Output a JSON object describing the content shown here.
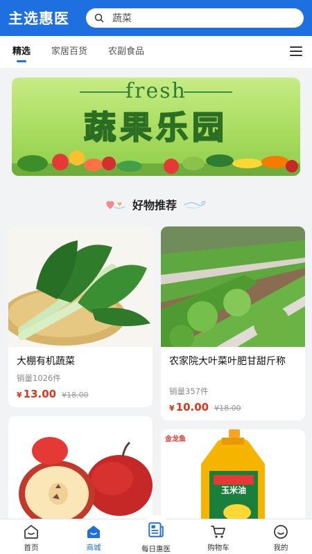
{
  "header": {
    "logo": "主选惠医",
    "search_text": "蔬菜",
    "brand_color": "#1e6fe0"
  },
  "tabs": [
    {
      "label": "精选",
      "active": true
    },
    {
      "label": "家居百货",
      "active": false
    },
    {
      "label": "农副食品",
      "active": false
    }
  ],
  "banner": {
    "subtitle": "fresh",
    "title": "蔬果乐园"
  },
  "section": {
    "title": "好物推荐"
  },
  "products": [
    {
      "name": "大棚有机蔬菜",
      "sales": "销量1026件",
      "currency": "¥",
      "price": "13.00",
      "old_price": "¥18.00",
      "image": "lettuce-stems"
    },
    {
      "name": "农家院大叶菜叶肥甘甜斤称",
      "sales": "销量357件",
      "currency": "¥",
      "price": "10.00",
      "old_price": "¥18.00",
      "image": "lettuce-field"
    },
    {
      "name": "",
      "sales": "",
      "price": "",
      "old_price": "",
      "image": "red-apples"
    },
    {
      "name": "",
      "sales": "",
      "price": "",
      "old_price": "",
      "image": "corn-oil-bottle",
      "brand_text": "金龙鱼",
      "bottle_label": "玉米油"
    }
  ],
  "bottom_nav": [
    {
      "label": "首页",
      "icon": "home-icon",
      "active": false
    },
    {
      "label": "商城",
      "icon": "shop-icon",
      "active": true
    },
    {
      "label": "每日惠医",
      "icon": "news-icon",
      "active": false
    },
    {
      "label": "购物车",
      "icon": "cart-icon",
      "active": false
    },
    {
      "label": "我的",
      "icon": "profile-icon",
      "active": false
    }
  ]
}
